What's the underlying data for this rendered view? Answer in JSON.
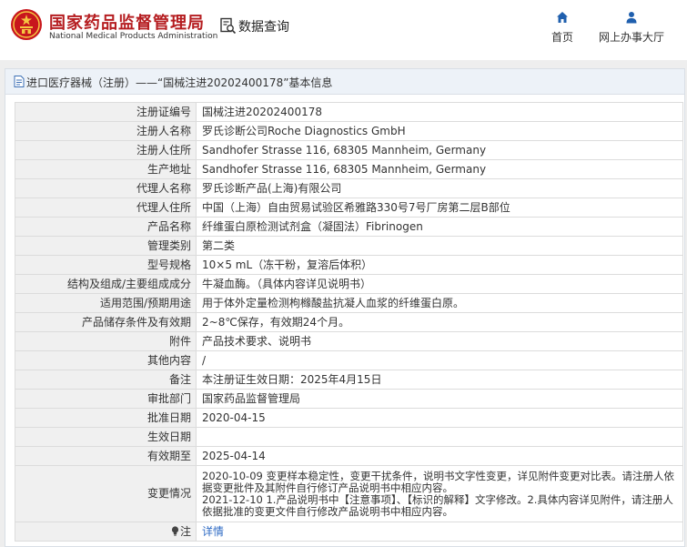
{
  "header": {
    "site_name_cn": "国家药品监督管理局",
    "site_name_en": "National Medical Products Administration",
    "query_label": "数据查询",
    "nav": {
      "home_label": "首页",
      "office_label": "网上办事大厅"
    }
  },
  "panel": {
    "title": "进口医疗器械（注册）——“国械注进20202400178”基本信息"
  },
  "rows": [
    {
      "key": "注册证编号",
      "value": "国械注进20202400178"
    },
    {
      "key": "注册人名称",
      "value": "罗氏诊断公司Roche Diagnostics GmbH"
    },
    {
      "key": "注册人住所",
      "value": "Sandhofer Strasse 116, 68305 Mannheim, Germany"
    },
    {
      "key": "生产地址",
      "value": "Sandhofer Strasse 116, 68305 Mannheim, Germany"
    },
    {
      "key": "代理人名称",
      "value": "罗氏诊断产品(上海)有限公司"
    },
    {
      "key": "代理人住所",
      "value": "中国（上海）自由贸易试验区希雅路330号7号厂房第二层B部位"
    },
    {
      "key": "产品名称",
      "value": "纤维蛋白原检测试剂盒（凝固法）Fibrinogen"
    },
    {
      "key": "管理类别",
      "value": "第二类"
    },
    {
      "key": "型号规格",
      "value": "10×5 mL（冻干粉，复溶后体积）"
    },
    {
      "key": "结构及组成/主要组成成分",
      "value": "牛凝血酶。（具体内容详见说明书）"
    },
    {
      "key": "适用范围/预期用途",
      "value": "用于体外定量检测枸橼酸盐抗凝人血浆的纤维蛋白原。"
    },
    {
      "key": "产品储存条件及有效期",
      "value": "2~8℃保存，有效期24个月。"
    },
    {
      "key": "附件",
      "value": "产品技术要求、说明书"
    },
    {
      "key": "其他内容",
      "value": "/"
    },
    {
      "key": "备注",
      "value": "本注册证生效日期：2025年4月15日"
    },
    {
      "key": "审批部门",
      "value": "国家药品监督管理局"
    },
    {
      "key": "批准日期",
      "value": "2020-04-15"
    },
    {
      "key": "生效日期",
      "value": ""
    },
    {
      "key": "有效期至",
      "value": "2025-04-14"
    }
  ],
  "changes": {
    "key": "变更情况",
    "line1": "2020-10-09 变更样本稳定性，变更干扰条件，说明书文字性变更，详见附件变更对比表。请注册人依据变更批件及其附件自行修订产品说明书中相应内容。",
    "line2": "2021-12-10 1.产品说明书中【注意事项】、【标识的解释】文字修改。2.具体内容详见附件，请注册人依据批准的变更文件自行修改产品说明书中相应内容。"
  },
  "note": {
    "key": "注",
    "link_label": "详情"
  },
  "colors": {
    "brand_red": "#b51d20",
    "link_blue": "#2f6bc4",
    "nav_blue": "#1f5fae",
    "title_bg": "#edf2f8"
  }
}
